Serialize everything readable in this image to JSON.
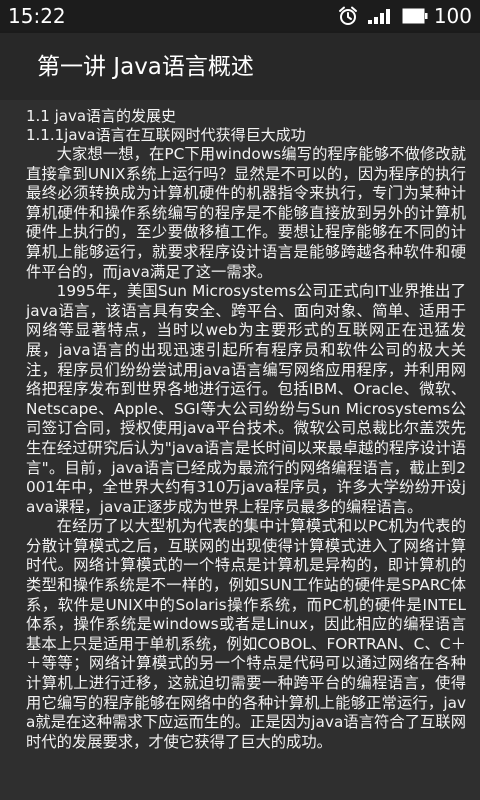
{
  "status_bar": {
    "time": "15:22",
    "battery": "100",
    "icons": [
      "alarm-icon",
      "signal-icon",
      "battery-icon"
    ]
  },
  "app_bar": {
    "title": "第一讲 Java语言概述"
  },
  "content": {
    "section_heading": "1.1 java语言的发展史",
    "subsection_heading": "1.1.1java语言在互联网时代获得巨大成功",
    "paragraphs": [
      "大家想一想，在PC下用windows编写的程序能够不做修改就直接拿到UNIX系统上运行吗？显然是不可以的，因为程序的执行最终必须转换成为计算机硬件的机器指令来执行，专门为某种计算机硬件和操作系统编写的程序是不能够直接放到另外的计算机硬件上执行的，至少要做移植工作。要想让程序能够在不同的计算机上能够运行，就要求程序设计语言是能够跨越各种软件和硬件平台的，而java满足了这一需求。",
      "1995年，美国Sun Microsystems公司正式向IT业界推出了java语言，该语言具有安全、跨平台、面向对象、简单、适用于网络等显著特点，当时以web为主要形式的互联网正在迅猛发展，java语言的出现迅速引起所有程序员和软件公司的极大关注，程序员们纷纷尝试用java语言编写网络应用程序，并利用网络把程序发布到世界各地进行运行。包括IBM、Oracle、微软、Netscape、Apple、SGI等大公司纷纷与Sun Microsystems公司签订合同，授权使用java平台技术。微软公司总裁比尔盖茨先生在经过研究后认为\"java语言是长时间以来最卓越的程序设计语言\"。目前，java语言已经成为最流行的网络编程语言，截止到2001年中，全世界大约有310万java程序员，许多大学纷纷开设java课程，java正逐步成为世界上程序员最多的编程语言。",
      "在经历了以大型机为代表的集中计算模式和以PC机为代表的分散计算模式之后，互联网的出现使得计算模式进入了网络计算时代。网络计算模式的一个特点是计算机是异构的，即计算机的类型和操作系统是不一样的，例如SUN工作站的硬件是SPARC体系，软件是UNIX中的Solaris操作系统，而PC机的硬件是INTEL体系，操作系统是windows或者是Linux，因此相应的编程语言基本上只是适用于单机系统，例如COBOL、FORTRAN、C、C＋＋等等；网络计算模式的另一个特点是代码可以通过网络在各种计算机上进行迁移，这就迫切需要一种跨平台的编程语言，使得用它编写的程序能够在网络中的各种计算机上能够正常运行，java就是在这种需求下应运而生的。正是因为java语言符合了互联网时代的发展要求，才使它获得了巨大的成功。"
    ]
  }
}
